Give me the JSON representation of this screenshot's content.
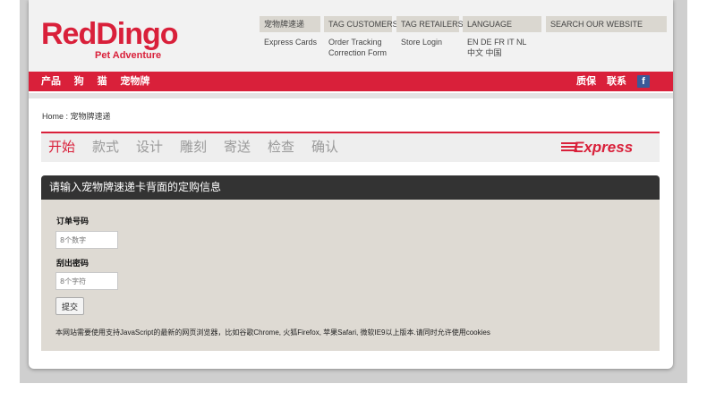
{
  "logo": {
    "main": "RedDingo",
    "sub": "Pet Adventure"
  },
  "topnav": [
    {
      "head": "宠物牌速递",
      "links": [
        "Express Cards"
      ]
    },
    {
      "head": "TAG CUSTOMERS",
      "links": [
        "Order Tracking",
        "Correction Form"
      ]
    },
    {
      "head": "TAG RETAILERS",
      "links": [
        "Store Login"
      ]
    },
    {
      "head": "LANGUAGE",
      "langs": [
        "EN",
        "DE",
        "FR",
        "IT",
        "NL",
        "中文"
      ],
      "current": "中国"
    },
    {
      "head": "SEARCH OUR WEBSITE"
    }
  ],
  "mainnav": {
    "left": [
      "产品",
      "狗",
      "猫",
      "宠物牌"
    ],
    "right": [
      "质保",
      "联系"
    ]
  },
  "breadcrumb": "Home : 宠物牌速递",
  "steps": [
    "开始",
    "款式",
    "设计",
    "雕刻",
    "寄送",
    "检查",
    "确认"
  ],
  "express_logo": "Express",
  "form": {
    "title": "请输入宠物牌速递卡背面的定购信息",
    "order_label": "订单号码",
    "order_placeholder": "8个数字",
    "code_label": "刮出密码",
    "code_placeholder": "8个字符",
    "submit": "提交",
    "notice": "本网站需要使用支持JavaScript的最新的网页浏览器，比如谷歌Chrome, 火狐Firefox, 苹果Safari, 微软IE9以上版本.请同时允许使用cookies"
  },
  "colors": {
    "brand_red": "#d9203a",
    "form_bg": "#dedad3",
    "title_bar": "#333333"
  }
}
